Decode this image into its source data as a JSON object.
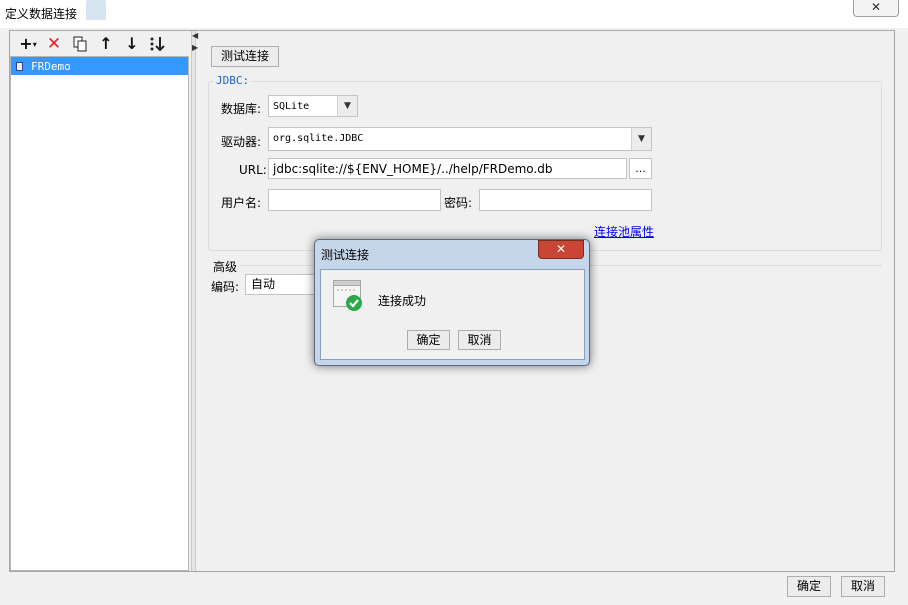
{
  "window": {
    "title": "定义数据连接",
    "close_glyph": "✕"
  },
  "toolbar": {
    "add_icon": "plus-dropdown-icon",
    "delete_icon": "red-x-icon",
    "copy_icon": "copy-icon",
    "up_icon": "arrow-up-icon",
    "down_icon": "arrow-down-icon",
    "sort_icon": "sort-icon"
  },
  "connections": [
    {
      "name": "FRDemo",
      "selected": true
    }
  ],
  "test_connection_label": "测试连接",
  "jdbc": {
    "group_title": "JDBC:",
    "database_label": "数据库:",
    "database_value": "SQLite",
    "driver_label": "驱动器:",
    "driver_value": "org.sqlite.JDBC",
    "url_label": "URL:",
    "url_value": "jdbc:sqlite://${ENV_HOME}/../help/FRDemo.db",
    "url_browse": "...",
    "username_label": "用户名:",
    "username_value": "",
    "password_label": "密码:",
    "password_value": "",
    "pool_link": "连接池属性"
  },
  "advanced": {
    "title": "高级",
    "encoding_label": "编码:",
    "encoding_value": "自动"
  },
  "footer": {
    "ok": "确定",
    "cancel": "取消"
  },
  "popup": {
    "title": "测试连接",
    "close_glyph": "✕",
    "message": "连接成功",
    "ok": "确定",
    "cancel": "取消",
    "icon": "success-check-icon"
  },
  "colors": {
    "selection": "#3399ff",
    "link": "#0000ee",
    "jdbc_title": "#1e63c8",
    "popup_close": "#c94636",
    "success": "#2ba84a"
  }
}
